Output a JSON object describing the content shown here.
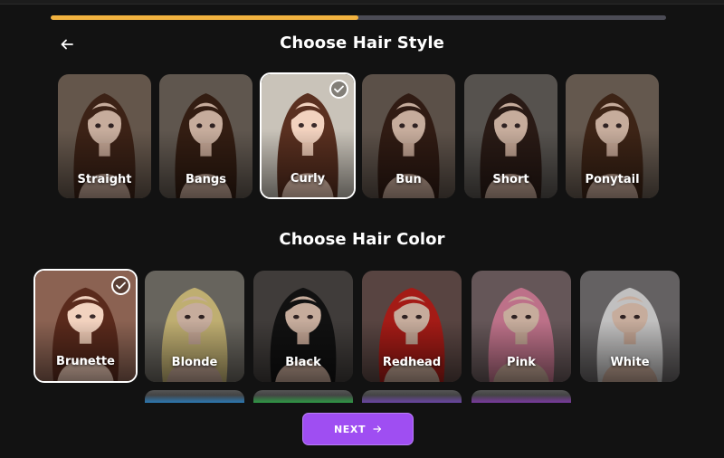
{
  "progress": {
    "fraction": 0.5
  },
  "back": {
    "icon": "arrow-left-icon"
  },
  "hair_style": {
    "title": "Choose Hair Style",
    "selected": "Curly",
    "options": [
      {
        "label": "Straight",
        "hair": "#4a2a1c",
        "bg": "#7b6a5c"
      },
      {
        "label": "Bangs",
        "hair": "#3f2417",
        "bg": "#756a60"
      },
      {
        "label": "Curly",
        "hair": "#5a3020",
        "bg": "#c9c3b9"
      },
      {
        "label": "Bun",
        "hair": "#3b2218",
        "bg": "#6f6258"
      },
      {
        "label": "Short",
        "hair": "#33201a",
        "bg": "#6a6460"
      },
      {
        "label": "Ponytail",
        "hair": "#4b2c1c",
        "bg": "#7a6c60"
      }
    ]
  },
  "hair_color": {
    "title": "Choose Hair Color",
    "selected": "Brunette",
    "options": [
      {
        "label": "Brunette",
        "hair": "#5a2a1c",
        "bg": "#8b6252"
      },
      {
        "label": "Blonde",
        "hair": "#e9d58a",
        "bg": "#7e7a72"
      },
      {
        "label": "Black",
        "hair": "#151515",
        "bg": "#4f4a47"
      },
      {
        "label": "Redhead",
        "hair": "#c8221c",
        "bg": "#6c5450"
      },
      {
        "label": "Pink",
        "hair": "#e78aa8",
        "bg": "#7c6a6c"
      },
      {
        "label": "White",
        "hair": "#ecebeb",
        "bg": "#7a7778"
      }
    ],
    "more_colors": [
      "#2b79b4",
      "#2f9a45",
      "#6b46a6",
      "#7a3aa0"
    ]
  },
  "next_button": {
    "label": "NEXT",
    "icon": "arrow-right-icon"
  }
}
